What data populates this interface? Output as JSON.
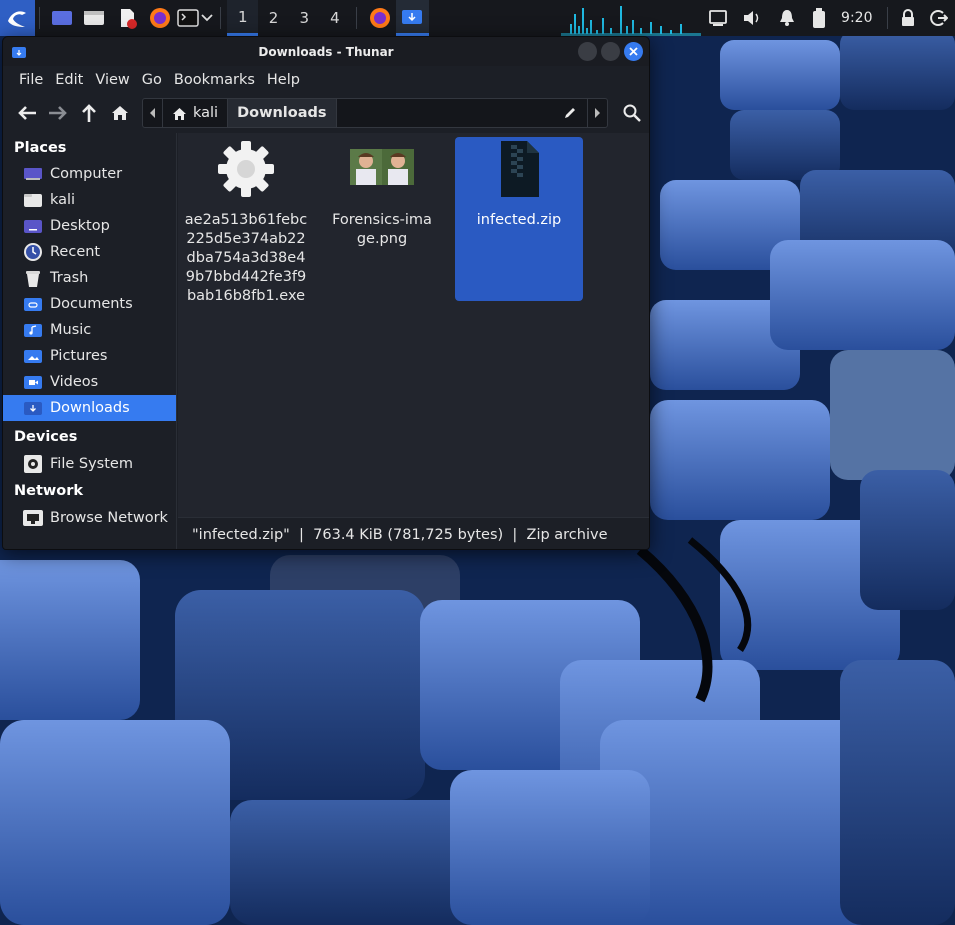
{
  "panel": {
    "workspaces": [
      "1",
      "2",
      "3",
      "4"
    ],
    "active_workspace": "1",
    "clock": "9:20",
    "icons": [
      "kali-menu-icon",
      "show-desktop-icon",
      "file-manager-icon",
      "text-editor-icon",
      "firefox-icon",
      "terminal-icon",
      "chevron-down-icon",
      "firefox-task-icon",
      "downloads-folder-task-icon",
      "network-icon",
      "volume-icon",
      "notification-bell-icon",
      "battery-icon",
      "lock-icon",
      "logout-icon"
    ]
  },
  "window": {
    "title": "Downloads - Thunar",
    "menu": [
      "File",
      "Edit",
      "View",
      "Go",
      "Bookmarks",
      "Help"
    ],
    "pathbar": {
      "home_label": "kali",
      "current_label": "Downloads"
    }
  },
  "sidebar": {
    "places_title": "Places",
    "places": [
      {
        "label": "Computer",
        "icon": "computer-icon"
      },
      {
        "label": "kali",
        "icon": "home-folder-icon"
      },
      {
        "label": "Desktop",
        "icon": "desktop-folder-icon"
      },
      {
        "label": "Recent",
        "icon": "recent-icon"
      },
      {
        "label": "Trash",
        "icon": "trash-icon"
      },
      {
        "label": "Documents",
        "icon": "documents-folder-icon"
      },
      {
        "label": "Music",
        "icon": "music-folder-icon"
      },
      {
        "label": "Pictures",
        "icon": "pictures-folder-icon"
      },
      {
        "label": "Videos",
        "icon": "videos-folder-icon"
      },
      {
        "label": "Downloads",
        "icon": "downloads-folder-icon"
      }
    ],
    "devices_title": "Devices",
    "devices": [
      {
        "label": "File System",
        "icon": "drive-icon"
      }
    ],
    "network_title": "Network",
    "network": [
      {
        "label": "Browse Network",
        "icon": "network-folder-icon"
      }
    ]
  },
  "files": [
    {
      "name": "ae2a513b61febc225d5e374ab22dba754a3d38e49b7bbd442fe3f9bab16b8fb1.exe",
      "icon": "executable-gear-icon"
    },
    {
      "name": "Forensics-image.png",
      "icon": "image-thumbnail-icon"
    },
    {
      "name": "infected.zip",
      "icon": "zip-archive-icon",
      "selected": true
    }
  ],
  "status": "\"infected.zip\"  |  763.4 KiB (781,725 bytes)  |  Zip archive",
  "colors": {
    "accent": "#367bf0",
    "panel": "#16181d",
    "window_bg": "#1c1f26",
    "view_bg": "#22252d",
    "selection": "#2a5ac2"
  }
}
